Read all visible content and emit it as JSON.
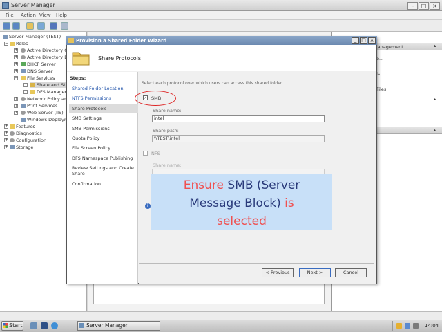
{
  "server_manager": {
    "title": "Server Manager",
    "menu": [
      "File",
      "Action",
      "View",
      "Help"
    ],
    "tree": [
      {
        "label": "Server Manager (TEST)",
        "level": 0
      },
      {
        "label": "Roles",
        "level": 1
      },
      {
        "label": "Active Directory C",
        "level": 2
      },
      {
        "label": "Active Directory D",
        "level": 2
      },
      {
        "label": "DHCP Server",
        "level": 2
      },
      {
        "label": "DNS Server",
        "level": 2
      },
      {
        "label": "File Services",
        "level": 2
      },
      {
        "label": "Share and St",
        "level": 3
      },
      {
        "label": "DFS Manager",
        "level": 3
      },
      {
        "label": "Network Policy an",
        "level": 2
      },
      {
        "label": "Print Services",
        "level": 2
      },
      {
        "label": "Web Server (IIS)",
        "level": 2
      },
      {
        "label": "Windows Deploym",
        "level": 2
      },
      {
        "label": "Features",
        "level": 1
      },
      {
        "label": "Diagnostics",
        "level": 1
      },
      {
        "label": "Configuration",
        "level": 1
      },
      {
        "label": "Storage",
        "level": 1
      }
    ],
    "actions": {
      "title": "Management",
      "items": [
        "e...",
        "ls...",
        "Files"
      ]
    }
  },
  "wizard": {
    "title": "Provision a Shared Folder Wizard",
    "header_title": "Share Protocols",
    "steps_label": "Steps:",
    "steps": [
      {
        "label": "Shared Folder Location",
        "state": "link"
      },
      {
        "label": "NTFS Permissions",
        "state": "link"
      },
      {
        "label": "Share Protocols",
        "state": "active"
      },
      {
        "label": "SMB Settings",
        "state": "normal"
      },
      {
        "label": "SMB Permissions",
        "state": "normal"
      },
      {
        "label": "Quota Policy",
        "state": "normal"
      },
      {
        "label": "File Screen Policy",
        "state": "normal"
      },
      {
        "label": "DFS Namespace Publishing",
        "state": "normal"
      },
      {
        "label": "Review Settings and Create",
        "state": "normal"
      },
      {
        "label": "Share",
        "state": "normal"
      },
      {
        "label": "Confirmation",
        "state": "normal"
      }
    ],
    "description": "Select each protocol over which users can access this shared folder.",
    "smb": {
      "label": "SMB",
      "checked": true,
      "share_name_label": "Share name:",
      "share_name_value": "intel",
      "share_path_label": "Share path:",
      "share_path_value": "\\\\TEST\\intel"
    },
    "nfs": {
      "label": "NFS",
      "checked": false,
      "share_name_label": "Share name:"
    },
    "buttons": {
      "previous": "< Previous",
      "next": "Next >",
      "cancel": "Cancel"
    }
  },
  "annotation": {
    "line1_red": "Ensure",
    "line1_blue": "SMB (Server",
    "line2_blue": "Message Block)",
    "line2_red": "is",
    "line3_red": "selected"
  },
  "taskbar": {
    "start": "Start",
    "task": "Server Manager",
    "clock": "14:04"
  },
  "colors": {
    "annotation_bg": "#c8e0f8",
    "annotation_red": "#f05050",
    "annotation_blue": "#2a3a7a",
    "highlight_oval": "#d22222",
    "link_blue": "#1b4fa8"
  }
}
